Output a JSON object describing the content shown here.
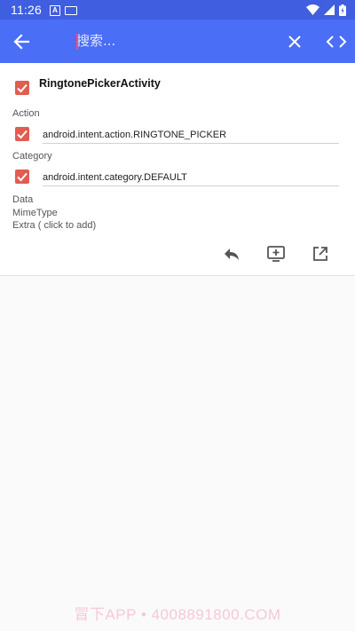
{
  "status_bar": {
    "time": "11:26",
    "icons": [
      "android-a-icon",
      "keyboard-icon",
      "wifi-icon",
      "signal-icon",
      "battery-icon"
    ]
  },
  "toolbar": {
    "search_placeholder": "搜索...",
    "icons": [
      "back-arrow-icon",
      "close-icon",
      "code-icon"
    ],
    "color": "#4a6ef5"
  },
  "card": {
    "activity": {
      "name": "RingtonePickerActivity",
      "checked": true
    },
    "action": {
      "label": "Action",
      "value": "android.intent.action.RINGTONE_PICKER",
      "checked": true
    },
    "category": {
      "label": "Category",
      "value": "android.intent.category.DEFAULT",
      "checked": true
    },
    "data_label": "Data",
    "mimetype_label": "MimeType",
    "extra_label": "Extra ( click to add)",
    "actions": [
      "reply-icon",
      "cast-screen-icon",
      "open-external-icon"
    ],
    "checkbox_color": "#e25c52"
  },
  "watermark": "冒下APP • 4008891800.COM"
}
